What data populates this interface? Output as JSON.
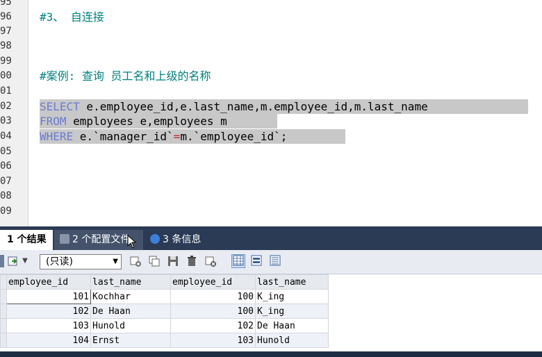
{
  "editor": {
    "line_numbers": [
      "95",
      "96",
      "97",
      "98",
      "99",
      "00",
      "01",
      "02",
      "03",
      "04",
      "05",
      "06",
      "07",
      "08",
      "09"
    ],
    "comment_selfjoin": "#3、 自连接",
    "comment_case": "#案例: 查询 员工名和上级的名称",
    "sql": {
      "select_kw": "SELECT",
      "select_cols": " e.employee_id,e.last_name,m.employee_id,m.last_name ",
      "from_kw": "FROM",
      "from_tables": " employees e,employees m ",
      "where_kw": "WHERE",
      "where_left": " e.`manager_id`",
      "where_op": "=",
      "where_right": "m.`employee_id`;"
    }
  },
  "tabs": [
    {
      "label": "1 个结果"
    },
    {
      "label": "2 个配置文件"
    },
    {
      "label": "3 条信息"
    }
  ],
  "toolbar": {
    "mode_select": "(只读)"
  },
  "grid": {
    "columns": [
      "employee_id",
      "last_name",
      "employee_id",
      "last_name"
    ],
    "rows": [
      [
        "101",
        "Kochhar",
        "100",
        "K_ing"
      ],
      [
        "102",
        "De Haan",
        "100",
        "K_ing"
      ],
      [
        "103",
        "Hunold",
        "102",
        "De Haan"
      ],
      [
        "104",
        "Ernst",
        "103",
        "Hunold"
      ]
    ]
  },
  "colors": {
    "keyword": "#6a7bd3",
    "comment": "#008080",
    "tabbar": "#2b3a55"
  }
}
